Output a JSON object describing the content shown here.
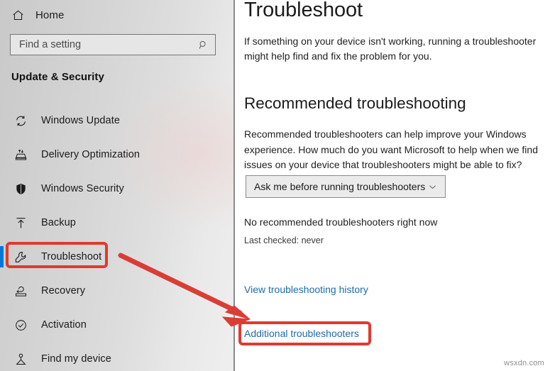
{
  "sidebar": {
    "home": {
      "label": "Home",
      "icon": "home-icon"
    },
    "search": {
      "value": "",
      "placeholder": "Find a setting",
      "icon": "search-icon"
    },
    "group_title": "Update & Security",
    "items": [
      {
        "label": "Windows Update",
        "icon": "refresh-icon",
        "selected": false
      },
      {
        "label": "Delivery Optimization",
        "icon": "delivery-optimization-icon",
        "selected": false
      },
      {
        "label": "Windows Security",
        "icon": "shield-icon",
        "selected": false
      },
      {
        "label": "Backup",
        "icon": "upload-arrow-icon",
        "selected": false
      },
      {
        "label": "Troubleshoot",
        "icon": "wrench-icon",
        "selected": true
      },
      {
        "label": "Recovery",
        "icon": "recovery-icon",
        "selected": false
      },
      {
        "label": "Activation",
        "icon": "check-circle-icon",
        "selected": false
      },
      {
        "label": "Find my device",
        "icon": "find-device-icon",
        "selected": false
      }
    ]
  },
  "main": {
    "title": "Troubleshoot",
    "intro": "If something on your device isn't working, running a troubleshooter might help find and fix the problem for you.",
    "section": {
      "title": "Recommended troubleshooting",
      "body": "Recommended troubleshooters can help improve your Windows experience. How much do you want Microsoft to help when we find issues on your device that troubleshooters might be able to fix?",
      "dropdown": {
        "value": "Ask me before running troubleshooters",
        "icon": "chevron-down-icon"
      },
      "status_main": "No recommended troubleshooters right now",
      "status_sub": "Last checked: never"
    },
    "links": {
      "history": "View troubleshooting history",
      "additional": "Additional troubleshooters"
    }
  },
  "annotations": {
    "highlight_color": "#e03a2f",
    "arrow_color": "#d93d35",
    "selection_color": "#0078d7",
    "link_color": "#1e6ba8"
  },
  "watermark": "wsxdn.com"
}
